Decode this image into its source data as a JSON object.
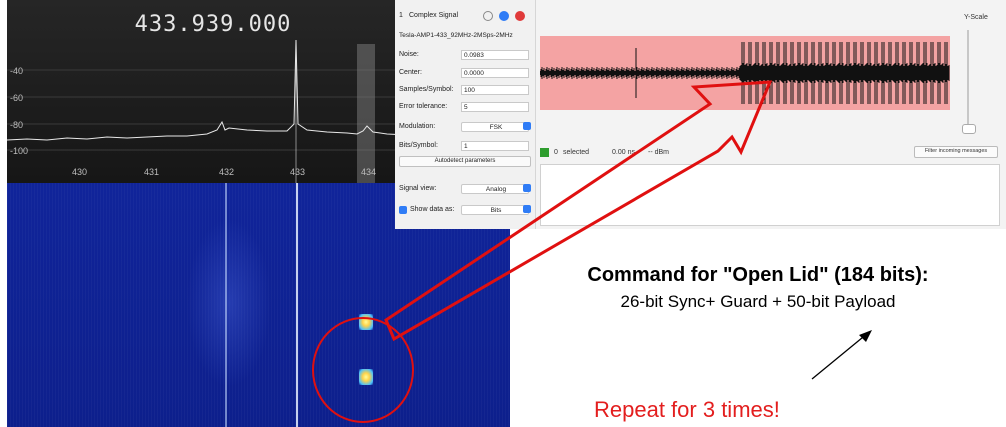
{
  "sdr": {
    "frequency": "433.939.000",
    "y_ticks": [
      "-40",
      "-60",
      "-80",
      "-100"
    ],
    "x_ticks": [
      "430",
      "431",
      "432",
      "433",
      "434"
    ]
  },
  "urh": {
    "signal_index": "1",
    "signal_name": "Complex Signal",
    "file_name": "Tesla-AMP1-433_92MHz-2MSps-2MHz",
    "noise_label": "Noise:",
    "noise_value": "0.0983",
    "center_label": "Center:",
    "center_value": "0.0000",
    "samples_label": "Samples/Symbol:",
    "samples_value": "100",
    "error_label": "Error tolerance:",
    "error_value": "5",
    "modulation_label": "Modulation:",
    "modulation_value": "FSK",
    "bits_label": "Bits/Symbol:",
    "bits_value": "1",
    "autodetect_label": "Autodetect parameters",
    "signal_view_label": "Signal view:",
    "signal_view_value": "Analog",
    "show_data_label": "Show data as:",
    "show_data_value": "Bits",
    "yscale_label": "Y-Scale",
    "selected_count": "0",
    "selected_label": "selected",
    "selected_time": "0.00 ns",
    "selected_power": "-- dBm",
    "filter_label": "Filter incoming messages"
  },
  "annotation": {
    "title": "Command for \"Open Lid\" (184 bits):",
    "subtitle": "26-bit Sync+ Guard + 50-bit Payload",
    "repeat": "Repeat for 3 times!"
  },
  "colors": {
    "arrow": "#e01010",
    "repeat_text": "#e31e1e",
    "plot_bg": "#f4a3a3",
    "waterfall": "#10249a",
    "accent_blue": "#2f7cf6"
  }
}
